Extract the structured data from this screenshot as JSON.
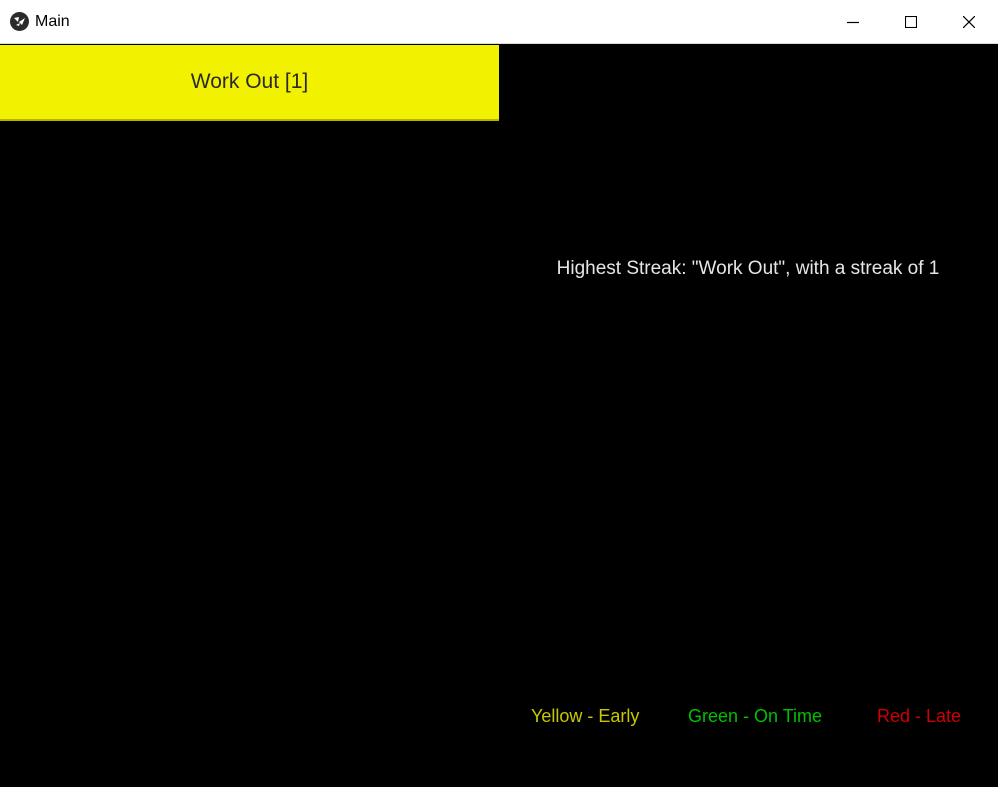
{
  "window": {
    "title": "Main",
    "icon": "kivy-app-icon"
  },
  "habits": [
    {
      "label": "Work Out [1]",
      "color": "#f2f200"
    }
  ],
  "stats": {
    "highest_streak_text": "Highest Streak: \"Work Out\", with a streak of 1"
  },
  "legend": {
    "early": {
      "label": "Yellow - Early",
      "color": "#c8c800"
    },
    "on_time": {
      "label": "Green - On Time",
      "color": "#00c000"
    },
    "late": {
      "label": "Red - Late",
      "color": "#d00000"
    }
  }
}
